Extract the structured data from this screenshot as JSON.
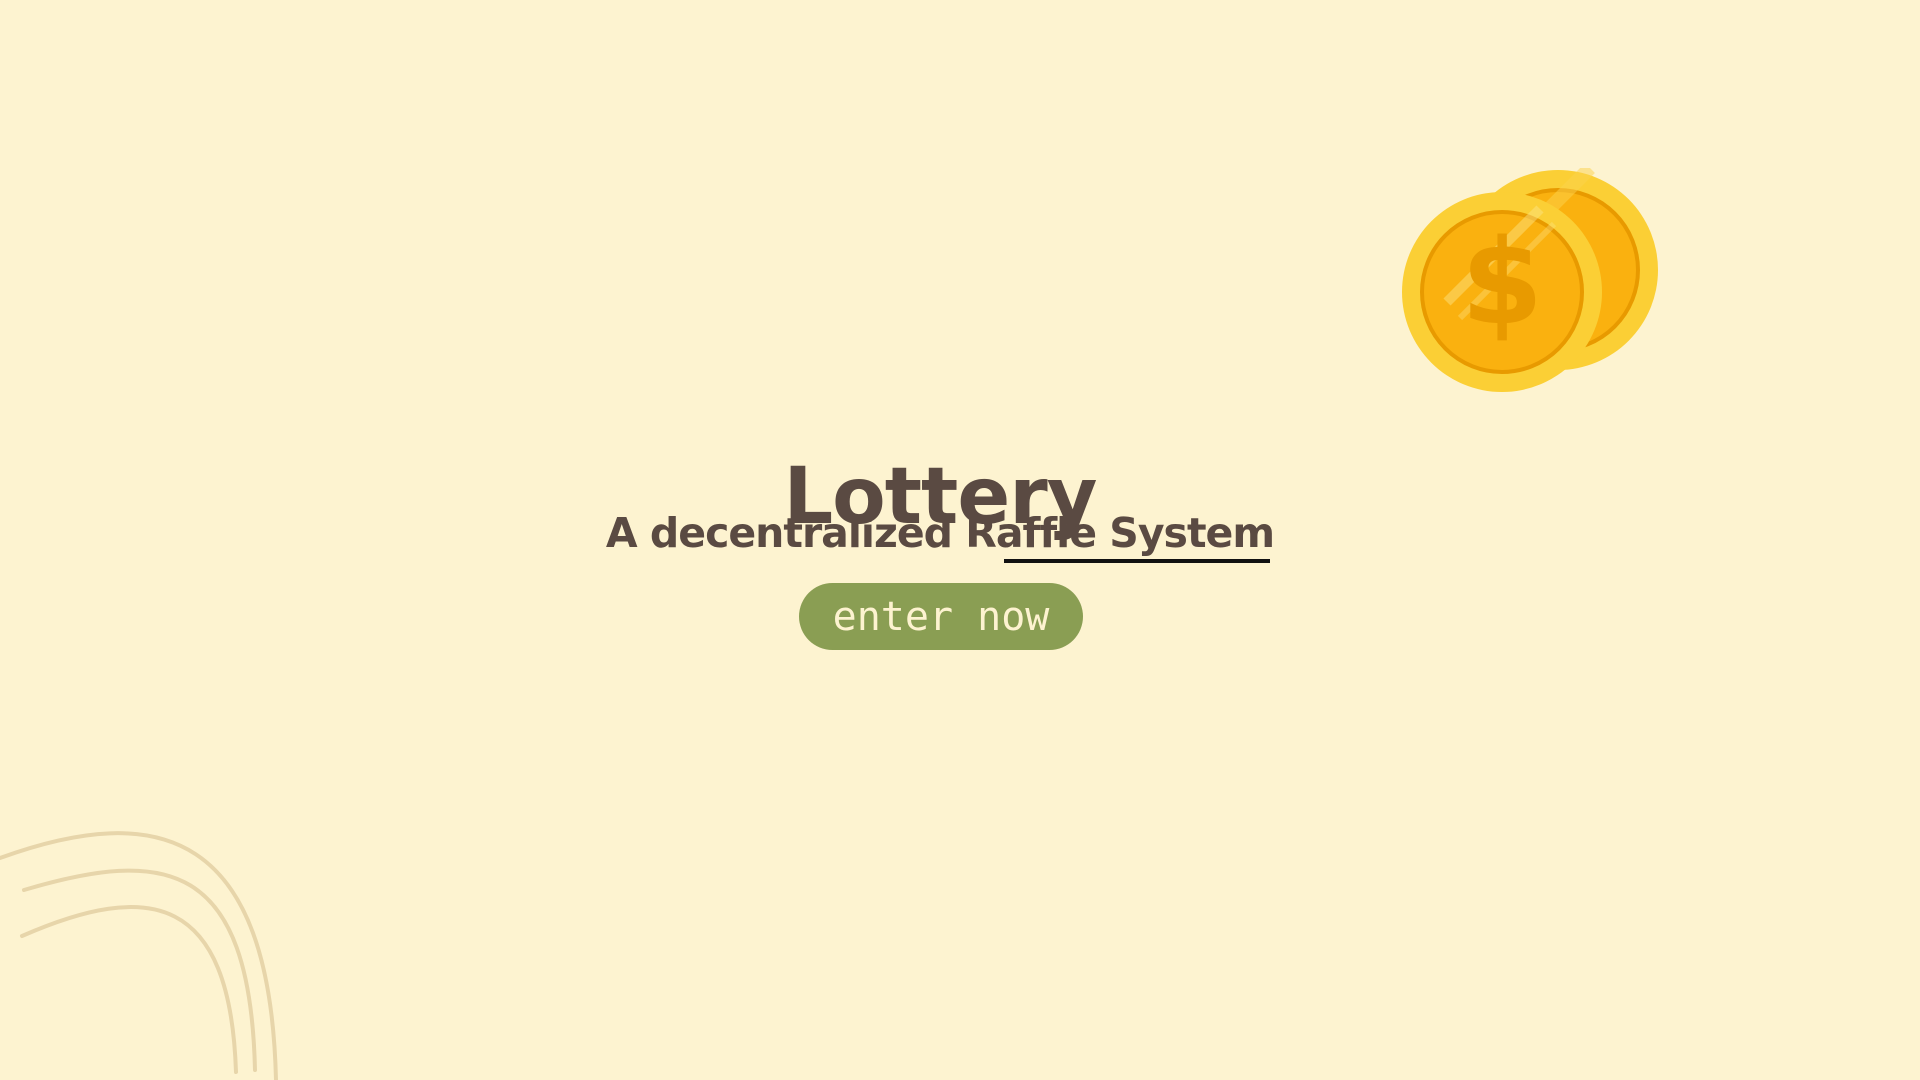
{
  "hero": {
    "title": "Lottery",
    "subtitle": "A decentralized Raffle System",
    "cta_label": "enter now"
  },
  "decorations": {
    "coin_icon": "gold-coins-icon",
    "coin_symbol": "$",
    "arc_icon": "decorative-arcs"
  },
  "colors": {
    "background": "#fdf3d0",
    "text": "#5a4a42",
    "button": "#8a9e53",
    "button_text": "#fdf3d0",
    "underline": "#111111",
    "coin_outer": "#fbcf35",
    "coin_inner": "#fab10f",
    "coin_symbol": "#e89a00"
  }
}
